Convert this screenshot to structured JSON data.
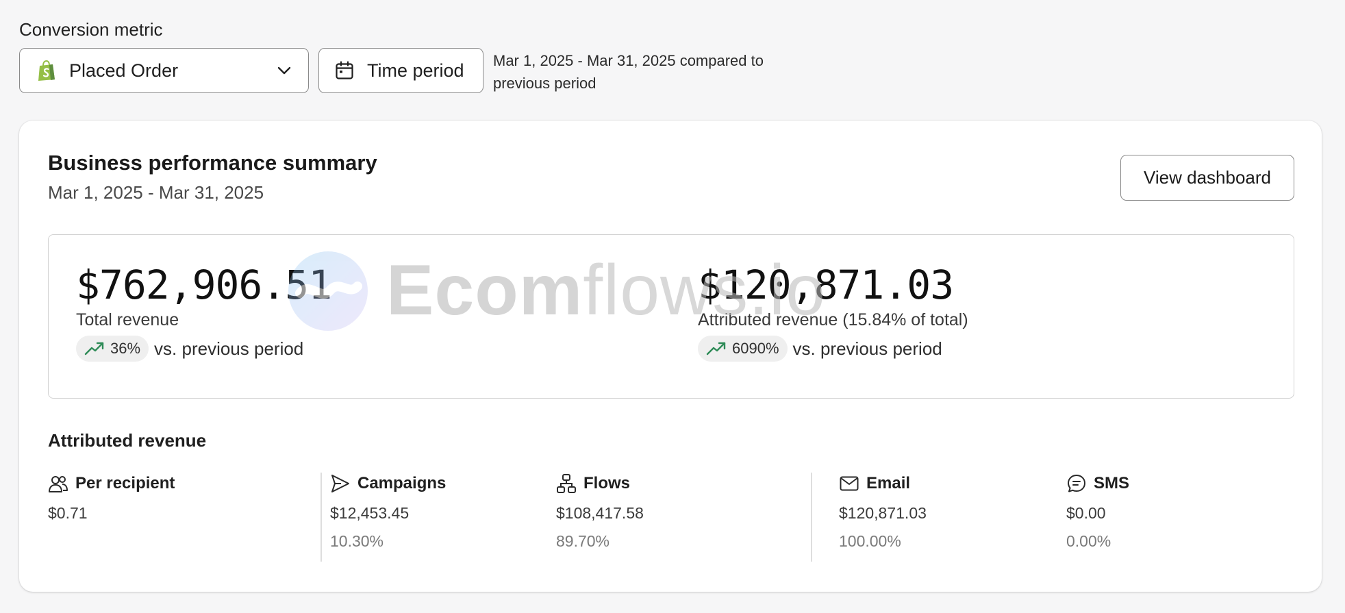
{
  "conversion_metric": {
    "label": "Conversion metric",
    "selected": "Placed Order",
    "selected_icon": "shopify-bag-icon"
  },
  "time_period": {
    "button_label": "Time period",
    "range_text": "Mar 1, 2025 - Mar 31, 2025 compared to previous period"
  },
  "summary_card": {
    "title": "Business performance summary",
    "date_range": "Mar 1, 2025 - Mar 31, 2025",
    "view_button": "View dashboard",
    "total_revenue": {
      "amount": "$762,906.51",
      "label": "Total revenue",
      "change": "36%",
      "change_direction": "up",
      "compare_text": "vs. previous period"
    },
    "attributed_revenue": {
      "amount": "$120,871.03",
      "label": "Attributed revenue (15.84% of total)",
      "change": "6090%",
      "change_direction": "up",
      "compare_text": "vs. previous period"
    },
    "watermark": "Ecomflows.io"
  },
  "attributed_section": {
    "title": "Attributed revenue",
    "metrics": [
      {
        "label": "Per recipient",
        "icon": "users-icon",
        "value": "$0.71",
        "percent": ""
      },
      {
        "label": "Campaigns",
        "icon": "send-icon",
        "value": "$12,453.45",
        "percent": "10.30%"
      },
      {
        "label": "Flows",
        "icon": "flows-icon",
        "value": "$108,417.58",
        "percent": "89.70%"
      },
      {
        "label": "Email",
        "icon": "mail-icon",
        "value": "$120,871.03",
        "percent": "100.00%"
      },
      {
        "label": "SMS",
        "icon": "sms-icon",
        "value": "$0.00",
        "percent": "0.00%"
      }
    ]
  },
  "colors": {
    "trend_up": "#2e8b57",
    "shopify_green": "#95bf47",
    "background": "#f6f6f7"
  }
}
